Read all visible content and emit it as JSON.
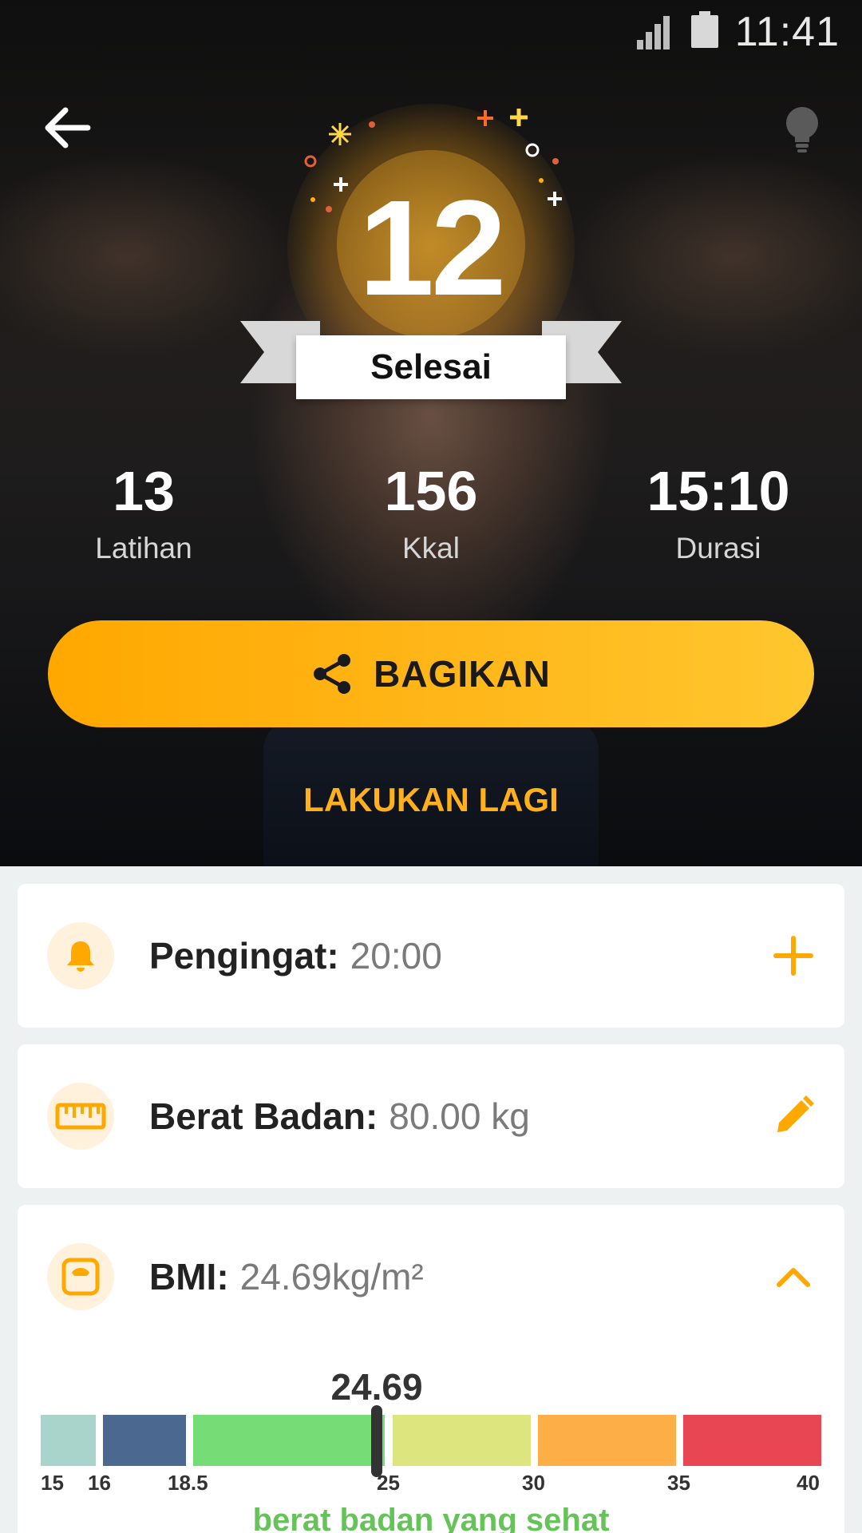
{
  "status_bar": {
    "time": "11:41",
    "icons": [
      "signal-icon",
      "battery-icon"
    ]
  },
  "hero": {
    "back_icon": "arrow-left-icon",
    "tip_icon": "lightbulb-icon",
    "completed_count": "12",
    "completed_label": "Selesai",
    "stats": [
      {
        "value": "13",
        "label": "Latihan"
      },
      {
        "value": "156",
        "label": "Kkal"
      },
      {
        "value": "15:10",
        "label": "Durasi"
      }
    ],
    "share_label": "BAGIKAN",
    "share_icon": "share-icon",
    "again_label": "LAKUKAN LAGI"
  },
  "reminder": {
    "label": "Pengingat:",
    "value": "20:00",
    "icon": "bell-icon",
    "action_icon": "plus-icon"
  },
  "weight": {
    "label": "Berat Badan:",
    "value": "80.00 kg",
    "icon": "ruler-icon",
    "action_icon": "pencil-icon"
  },
  "bmi": {
    "label": "BMI:",
    "value": "24.69kg/m²",
    "icon": "scale-icon",
    "action_icon": "chevron-up-icon",
    "indicator_value": "24.69",
    "ticks": [
      "15",
      "16",
      "18.5",
      "25",
      "30",
      "35",
      "40"
    ],
    "segment_colors": [
      "#a8d4cc",
      "#4a6890",
      "#76dc76",
      "#dde67e",
      "#fdae46",
      "#e84652"
    ],
    "status": "berat badan yang sehat"
  },
  "colors": {
    "accent": "#ffb01a",
    "icon_bg": "#fff1dc"
  }
}
